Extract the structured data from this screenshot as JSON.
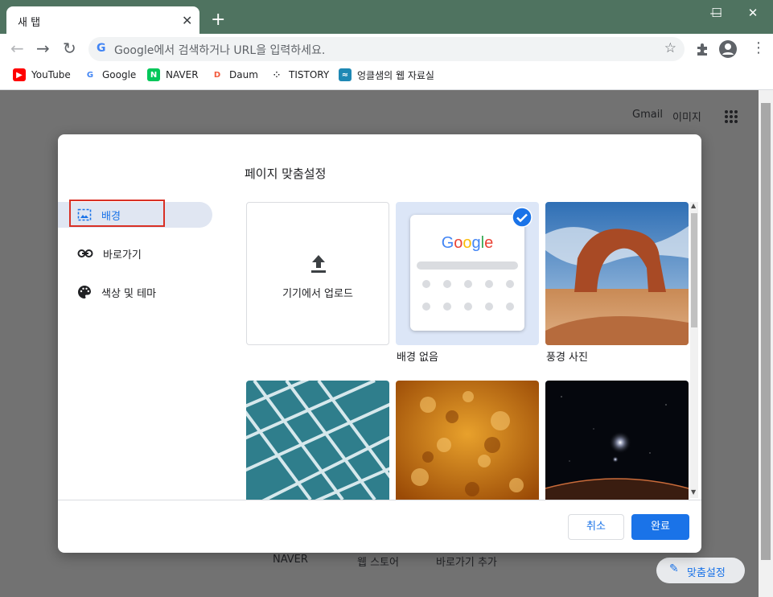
{
  "tab": {
    "title": "새 탭",
    "close": "✕",
    "new_tab": "+"
  },
  "window_controls": {
    "minimize": "—",
    "maximize": "☐",
    "close": "✕"
  },
  "omnibox": {
    "placeholder": "Google에서 검색하거나 URL을 입력하세요.",
    "g_letter": "G"
  },
  "bookmarks": [
    {
      "label": "YouTube",
      "icon": "youtube-icon",
      "color": "#ff0000",
      "glyph": "▶"
    },
    {
      "label": "Google",
      "icon": "google-icon",
      "color": "#ffffff",
      "glyph": "G"
    },
    {
      "label": "NAVER",
      "icon": "naver-icon",
      "color": "#03c75a",
      "glyph": "N"
    },
    {
      "label": "Daum",
      "icon": "daum-icon",
      "color": "#ffffff",
      "glyph": "D"
    },
    {
      "label": "TISTORY",
      "icon": "tistory-icon",
      "color": "#ffffff",
      "glyph": "⁘"
    },
    {
      "label": "엉클샘의 웹 자료실",
      "icon": "uncle-sam-icon",
      "color": "#1e88b4",
      "glyph": "≈"
    }
  ],
  "header_links": {
    "gmail": "Gmail",
    "images": "이미지"
  },
  "bottom_links": {
    "naver": "NAVER",
    "web_store": "웹 스토어",
    "add_shortcut": "바로가기 추가",
    "customize": "맞춤설정"
  },
  "dialog": {
    "title": "페이지 맞춤설정",
    "nav": [
      {
        "label": "배경",
        "icon": "background-icon",
        "active": true
      },
      {
        "label": "바로가기",
        "icon": "link-icon",
        "active": false
      },
      {
        "label": "색상 및 테마",
        "icon": "palette-icon",
        "active": false
      }
    ],
    "tiles": {
      "upload_label": "기기에서 업로드",
      "no_background_label": "배경 없음",
      "landscape_label": "풍경 사진"
    },
    "google_logo": "Google",
    "cancel_label": "취소",
    "done_label": "완료"
  },
  "colors": {
    "accent": "#1a73e8",
    "frame": "#4f7360",
    "highlight_box": "#d93025"
  }
}
